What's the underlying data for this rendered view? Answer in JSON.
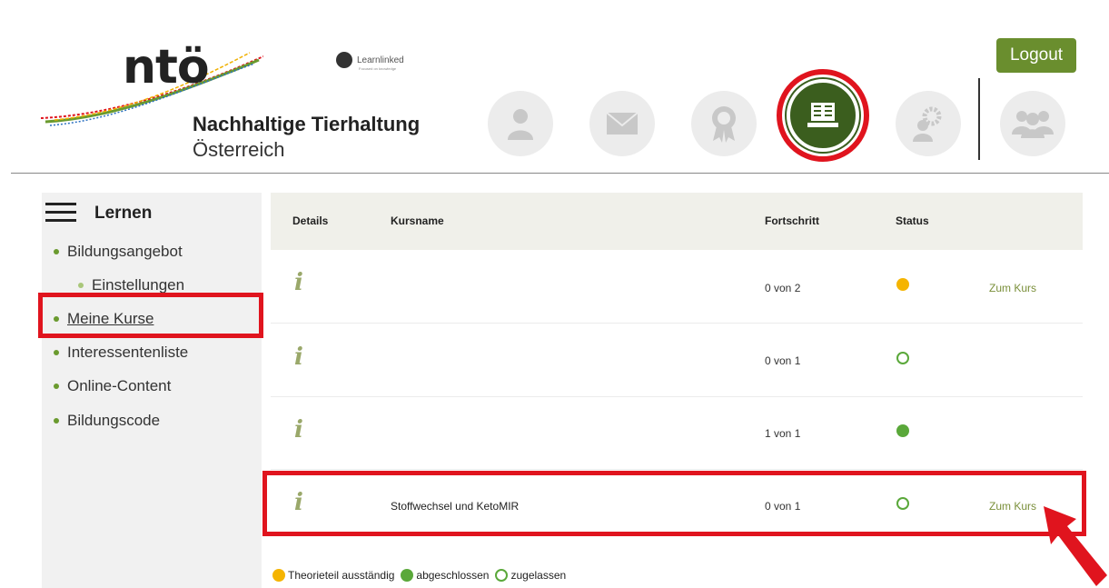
{
  "brand": {
    "logo_text": "ntö",
    "line1": "Nachhaltige Tierhaltung",
    "line2": "Österreich",
    "partner_logo": "Learnlinked",
    "partner_tagline": "Focused on knowledge"
  },
  "nav": {
    "icons": [
      "profile-icon",
      "mail-icon",
      "certificate-icon",
      "learning-icon",
      "admin-settings-icon",
      "group-icon"
    ],
    "active": "learning-icon",
    "logout_label": "Logout"
  },
  "colors": {
    "accent_green": "#6a8e2e",
    "active_green": "#3b5e1e",
    "highlight_red": "#e0141e",
    "status_pending": "#f5b400",
    "status_done": "#5aa83a"
  },
  "sidebar": {
    "title": "Lernen",
    "items": [
      {
        "label": "Bildungsangebot"
      },
      {
        "label": "Einstellungen"
      },
      {
        "label": "Meine Kurse"
      },
      {
        "label": "Interessentenliste"
      },
      {
        "label": "Online-Content"
      },
      {
        "label": "Bildungscode"
      }
    ]
  },
  "table": {
    "headers": {
      "details": "Details",
      "name": "Kursname",
      "progress": "Fortschritt",
      "status": "Status"
    },
    "rows": [
      {
        "info": "i",
        "name": "",
        "progress": "0 von 2",
        "status": "pending",
        "link": "Zum Kurs"
      },
      {
        "info": "i",
        "name": "",
        "progress": "0 von 1",
        "status": "allowed",
        "link": ""
      },
      {
        "info": "i",
        "name": "",
        "progress": "1 von 1",
        "status": "done",
        "link": ""
      },
      {
        "info": "i",
        "name": "Stoffwechsel und KetoMIR",
        "progress": "0 von 1",
        "status": "allowed",
        "link": "Zum Kurs"
      }
    ]
  },
  "legend": {
    "pending": "Theorieteil ausständig",
    "done": "abgeschlossen",
    "allowed": "zugelassen"
  }
}
